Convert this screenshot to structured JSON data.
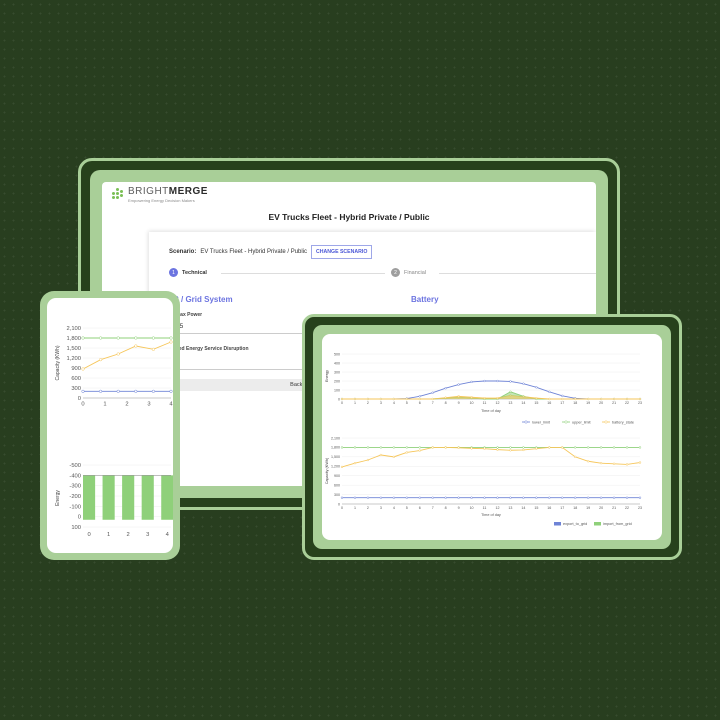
{
  "colors": {
    "background": "#283e1f",
    "device_frame": "#a9cf98",
    "accent": "#6c74e0",
    "series_blue": "#6e83d6",
    "series_green": "#8fd07a",
    "series_yellow": "#f6c65a",
    "brand_green": "#7bbf55"
  },
  "desktop": {
    "logo": {
      "bright": "BRIGHT",
      "merge": "MERGE",
      "tagline": "Empowering Energy Decision Makers"
    },
    "app_title": "EV Trucks Fleet - Hybrid Private / Public",
    "scenario_label": "Scenario:",
    "scenario_value": "EV Trucks Fleet - Hybrid Private / Public",
    "change_button": "CHANGE SCENARIO",
    "steps": [
      {
        "num": "1",
        "label": "Technical"
      },
      {
        "num": "2",
        "label": "Financial"
      }
    ],
    "section_left": "R / Grid System",
    "section_right": "Battery",
    "field1_label": "Max Power",
    "field1_value": "35",
    "field2_label": "sed Energy Service Disruption",
    "file_value": "Backabol_Input_FULL_YE"
  },
  "chart_data": [
    {
      "id": "phone_capacity",
      "type": "line",
      "ylabel": "Capacity (KWh)",
      "x": [
        0,
        1,
        2,
        3,
        4
      ],
      "ylim": [
        0,
        2100
      ],
      "yticks": [
        "0",
        "300",
        "600",
        "900",
        "1,200",
        "1,500",
        "1,800",
        "2,100"
      ],
      "series": [
        {
          "color": "#8fd07a",
          "values": [
            1800,
            1800,
            1800,
            1800,
            1800,
            1800
          ]
        },
        {
          "color": "#f6c65a",
          "values": [
            870,
            1150,
            1320,
            1560,
            1460,
            1680
          ]
        },
        {
          "color": "#6e83d6",
          "values": [
            200,
            200,
            200,
            200,
            200,
            200
          ]
        }
      ]
    },
    {
      "id": "phone_energy",
      "type": "bar",
      "ylabel": "Energy",
      "categories": [
        "0",
        "1",
        "2",
        "3",
        "4"
      ],
      "ylim": [
        -500,
        100
      ],
      "yticks": [
        "100",
        "0",
        "-100",
        "-200",
        "-300",
        "-400",
        "-500"
      ],
      "values": [
        -430,
        -430,
        -430,
        -430,
        -430
      ]
    },
    {
      "id": "tablet_energy",
      "type": "line",
      "ylabel": "Energy",
      "xlabel": "Time of day",
      "ylim": [
        0,
        500
      ],
      "yticks": [
        "0",
        "100",
        "200",
        "300",
        "400",
        "500"
      ],
      "x": [
        0,
        1,
        2,
        3,
        4,
        5,
        6,
        7,
        8,
        9,
        10,
        11,
        12,
        13,
        14,
        15,
        16,
        17,
        18,
        19,
        20,
        21,
        22,
        23
      ],
      "series": [
        {
          "name": "lower_limit",
          "color": "#6e83d6",
          "values": [
            0,
            0,
            0,
            0,
            0,
            5,
            30,
            70,
            120,
            160,
            190,
            200,
            200,
            195,
            170,
            130,
            80,
            35,
            8,
            0,
            0,
            0,
            0,
            0
          ]
        },
        {
          "name": "upper_limit",
          "color": "#8fd07a",
          "values": [
            0,
            0,
            0,
            0,
            0,
            0,
            0,
            0,
            10,
            20,
            10,
            0,
            0,
            80,
            30,
            0,
            0,
            0,
            0,
            0,
            0,
            0,
            0,
            0
          ]
        },
        {
          "name": "battery_state",
          "color": "#f6c65a",
          "values": [
            0,
            0,
            0,
            0,
            0,
            0,
            0,
            0,
            15,
            30,
            20,
            10,
            10,
            40,
            25,
            10,
            0,
            0,
            0,
            0,
            0,
            0,
            0,
            0
          ]
        }
      ]
    },
    {
      "id": "tablet_capacity",
      "type": "line",
      "ylabel": "Capacity (KWh)",
      "xlabel": "Time of day",
      "ylim": [
        0,
        2100
      ],
      "yticks": [
        "0",
        "300",
        "600",
        "900",
        "1,200",
        "1,500",
        "1,800",
        "2,100"
      ],
      "x": [
        0,
        1,
        2,
        3,
        4,
        5,
        6,
        7,
        8,
        9,
        10,
        11,
        12,
        13,
        14,
        15,
        16,
        17,
        18,
        19,
        20,
        21,
        22,
        23
      ],
      "series": [
        {
          "name": "export_to_grid",
          "color": "#6e83d6",
          "values": [
            200,
            200,
            200,
            200,
            200,
            200,
            200,
            200,
            200,
            200,
            200,
            200,
            200,
            200,
            200,
            200,
            200,
            200,
            200,
            200,
            200,
            200,
            200,
            200
          ]
        },
        {
          "name": "import_from_grid",
          "color": "#8fd07a",
          "values": [
            1800,
            1800,
            1800,
            1800,
            1800,
            1800,
            1800,
            1800,
            1800,
            1800,
            1800,
            1800,
            1800,
            1800,
            1800,
            1800,
            1800,
            1800,
            1800,
            1800,
            1800,
            1800,
            1800,
            1800
          ]
        },
        {
          "name": "",
          "color": "#f6c65a",
          "values": [
            1180,
            1300,
            1400,
            1560,
            1500,
            1640,
            1700,
            1800,
            1800,
            1790,
            1770,
            1760,
            1730,
            1710,
            1720,
            1760,
            1800,
            1800,
            1500,
            1360,
            1300,
            1280,
            1260,
            1320
          ]
        }
      ]
    }
  ]
}
